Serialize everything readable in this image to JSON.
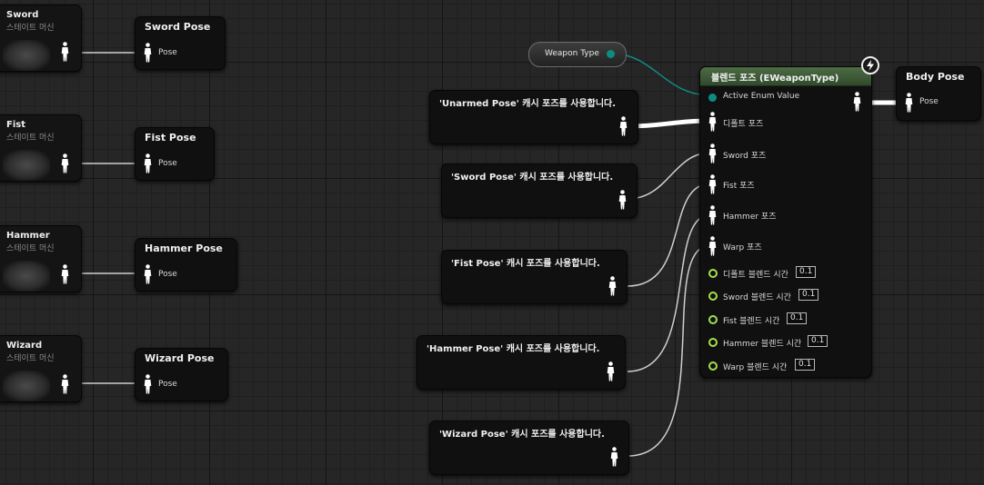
{
  "graph": {
    "state_machines": [
      {
        "title": "Sword",
        "subtitle": "스테이트 머신"
      },
      {
        "title": "Fist",
        "subtitle": "스테이트 머신"
      },
      {
        "title": "Hammer",
        "subtitle": "스테이트 머신"
      },
      {
        "title": "Wizard",
        "subtitle": "스테이트 머신"
      }
    ],
    "save_pose_nodes": [
      {
        "title": "Sword Pose",
        "pin": "Pose"
      },
      {
        "title": "Fist Pose",
        "pin": "Pose"
      },
      {
        "title": "Hammer Pose",
        "pin": "Pose"
      },
      {
        "title": "Wizard Pose",
        "pin": "Pose"
      }
    ],
    "weapon_type": {
      "label": "Weapon Type"
    },
    "cached_pose_nodes": [
      {
        "title": "'Unarmed Pose' 캐시 포즈를 사용합니다."
      },
      {
        "title": "'Sword Pose' 캐시 포즈를 사용합니다."
      },
      {
        "title": "'Fist Pose' 캐시 포즈를 사용합니다."
      },
      {
        "title": "'Hammer Pose' 캐시 포즈를 사용합니다."
      },
      {
        "title": "'Wizard Pose' 캐시 포즈를 사용합니다."
      }
    ],
    "blend_node": {
      "title": "블렌드 포즈 (EWeaponType)",
      "active_enum_pin": "Active Enum Value",
      "pose_pins": [
        "디폴트 포즈",
        "Sword 포즈",
        "Fist 포즈",
        "Hammer 포즈",
        "Warp 포즈"
      ],
      "blend_time_pins": [
        {
          "label": "디폴트 블렌드 시간",
          "value": "0.1"
        },
        {
          "label": "Sword 블렌드 시간",
          "value": "0.1"
        },
        {
          "label": "Fist 블렌드 시간",
          "value": "0.1"
        },
        {
          "label": "Hammer 블렌드 시간",
          "value": "0.1"
        },
        {
          "label": "Warp 블렌드 시간",
          "value": "0.1"
        }
      ]
    },
    "output_node": {
      "title": "Body Pose",
      "pin": "Pose"
    }
  },
  "colors": {
    "pose_wire": "#d9d9d9",
    "enum_wire": "#0e8c82",
    "float_pin": "#a4e04c",
    "blend_header": "#3f5a38"
  }
}
